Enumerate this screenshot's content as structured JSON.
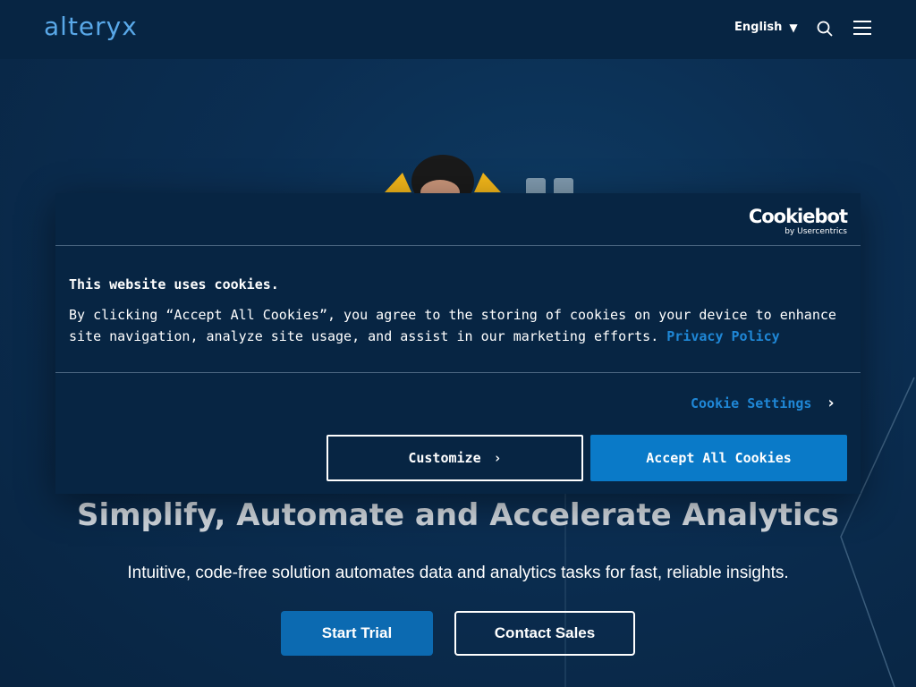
{
  "header": {
    "logo": "alteryx",
    "language": "English"
  },
  "hero": {
    "title": "Simplify, Automate and Accelerate Analytics",
    "subtitle": "Intuitive, code-free solution automates data and analytics tasks for fast, reliable insights.",
    "start_trial": "Start Trial",
    "contact_sales": "Contact Sales"
  },
  "cookie_banner": {
    "brand": "Cookiebot",
    "brand_by": "by Usercentrics",
    "title": "This website uses cookies.",
    "body": "By clicking “Accept All Cookies”, you agree to the storing of cookies on your device to enhance site navigation, analyze site usage, and assist in our marketing efforts.",
    "privacy_link": "Privacy Policy",
    "settings_label": "Cookie Settings",
    "customize_label": "Customize",
    "accept_label": "Accept All Cookies"
  },
  "colors": {
    "accent": "#1f87d6",
    "button_primary": "#0a7ac8",
    "background": "#0b2a4a"
  }
}
